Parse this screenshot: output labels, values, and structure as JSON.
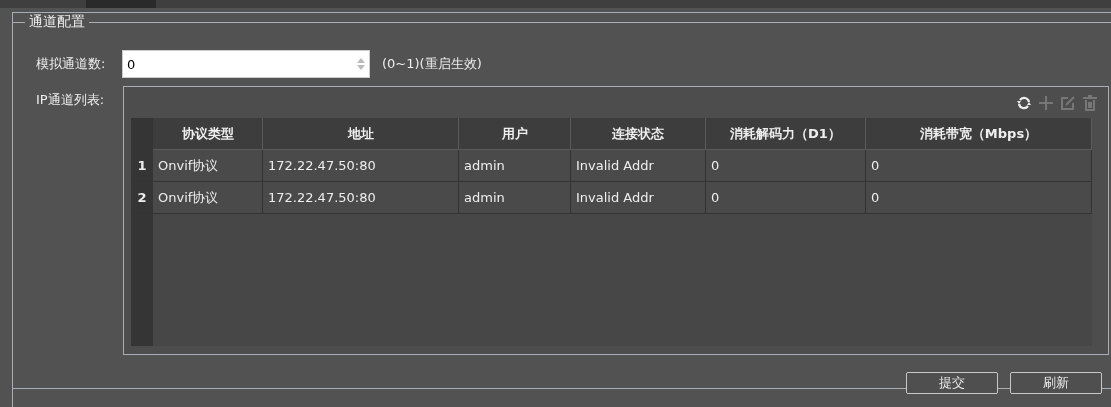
{
  "group": {
    "title": "通道配置"
  },
  "analog_channels": {
    "label": "模拟通道数:",
    "value": "0",
    "hint": "(0~1)(重启生效)"
  },
  "ip_list": {
    "label": "IP通道列表:",
    "table": {
      "columns": [
        "协议类型",
        "地址",
        "用户",
        "连接状态",
        "消耗解码力（D1）",
        "消耗带宽（Mbps）"
      ],
      "rows": [
        {
          "index": "1",
          "cells": [
            "Onvif协议",
            "172.22.47.50:80",
            "admin",
            "Invalid Addr",
            "0",
            "0"
          ]
        },
        {
          "index": "2",
          "cells": [
            "Onvif协议",
            "172.22.47.50:80",
            "admin",
            "Invalid Addr",
            "0",
            "0"
          ]
        }
      ]
    }
  },
  "buttons": [
    "提交",
    "刷新"
  ]
}
